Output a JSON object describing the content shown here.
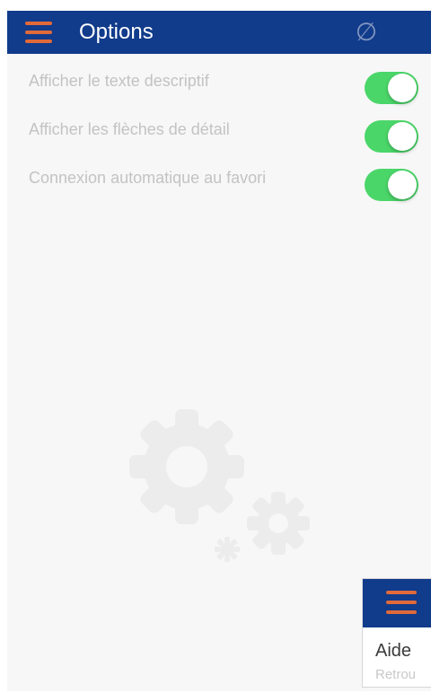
{
  "header": {
    "title": "Options",
    "menu_icon": "hamburger-menu-icon",
    "action_symbol": "∅",
    "action_icon": "empty-set-icon"
  },
  "options": [
    {
      "label": "Afficher le texte descriptif",
      "enabled": true
    },
    {
      "label": "Afficher les flèches de détail",
      "enabled": true
    },
    {
      "label": "Connexion automatique au favori",
      "enabled": true
    }
  ],
  "background_icon": "gears-icon",
  "preview_card": {
    "title": "Aide",
    "subtitle": "Retrou",
    "menu_icon": "hamburger-menu-icon"
  },
  "colors": {
    "header": "#113b8b",
    "menu_icon": "#e06a3a",
    "toggle_on": "#4bd669",
    "option_text": "#c3c3c3",
    "background": "#f7f7f7"
  }
}
